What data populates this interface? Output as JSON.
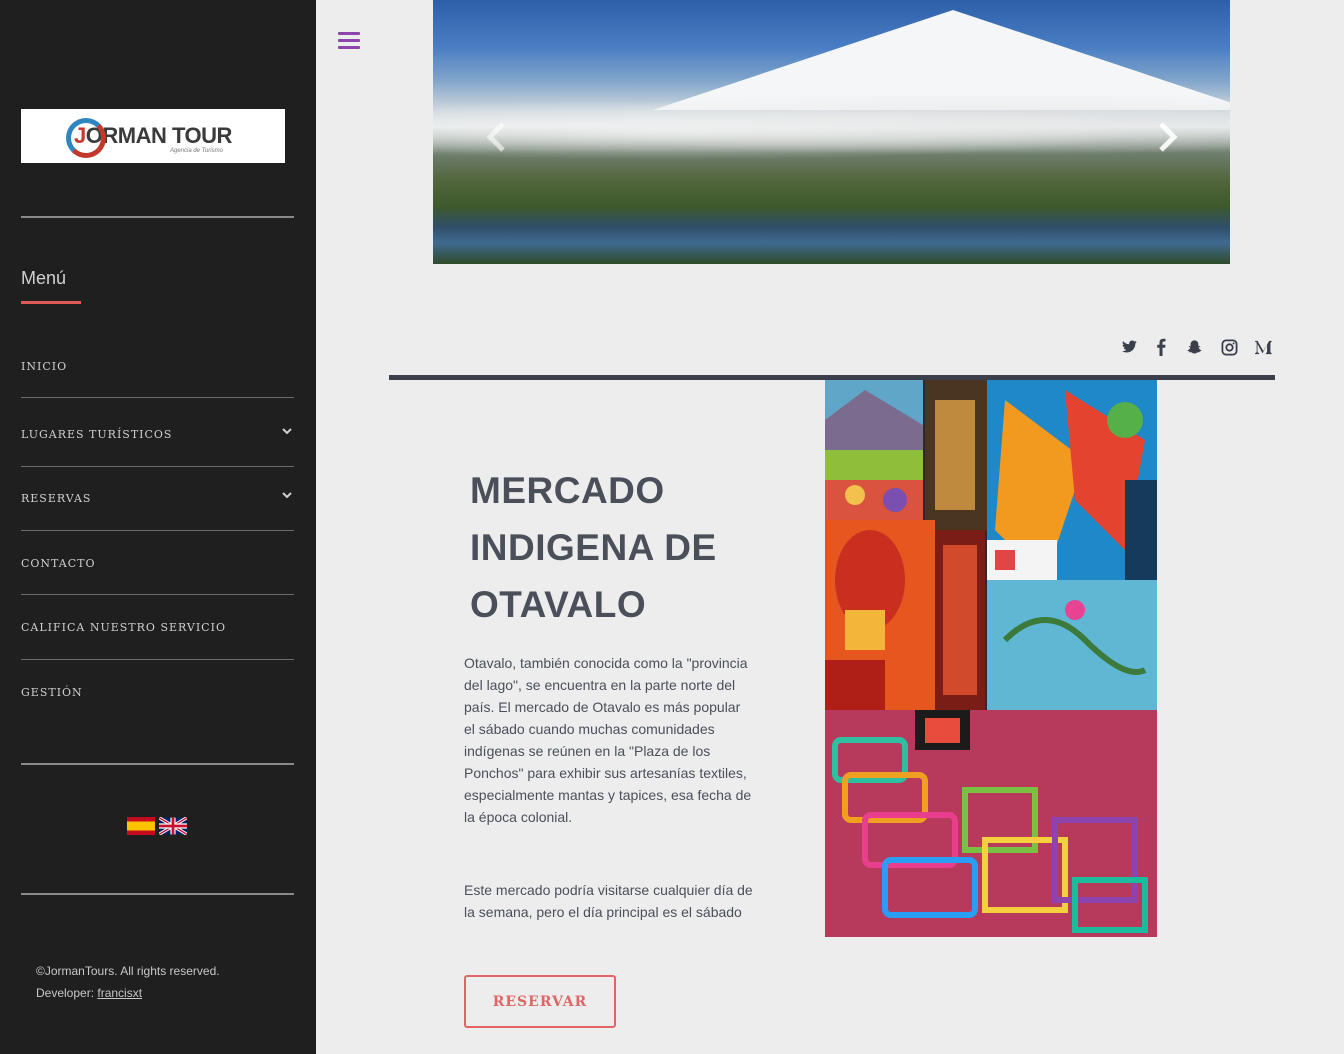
{
  "brand": {
    "logo_text_prefix": "J",
    "logo_text_main": "ORMAN TOUR",
    "logo_tagline": "Agencia de Turismo"
  },
  "sidebar": {
    "menu_title": "Menú",
    "items": [
      {
        "label": "INICIO",
        "has_submenu": false
      },
      {
        "label": "LUGARES TURÍSTICOS",
        "has_submenu": true
      },
      {
        "label": "RESERVAS",
        "has_submenu": true
      },
      {
        "label": "CONTACTO",
        "has_submenu": false
      },
      {
        "label": "CALIFICA NUESTRO SERVICIO",
        "has_submenu": false
      },
      {
        "label": "GESTIÓN",
        "has_submenu": false
      }
    ],
    "languages": [
      {
        "name": "spain-flag-icon"
      },
      {
        "name": "uk-flag-icon"
      }
    ],
    "footer": {
      "copyright": "©JormanTours. All rights reserved.",
      "developer_label": "Developer: ",
      "developer_link": "francisxt"
    }
  },
  "social": [
    "twitter-icon",
    "facebook-icon",
    "snapchat-icon",
    "instagram-icon",
    "medium-icon"
  ],
  "article": {
    "title_line1": "MERCADO",
    "title_line2": "INDIGENA DE",
    "title_line3": "OTAVALO",
    "paragraph1": "Otavalo, también conocida como la \"provincia del lago\", se encuentra en la parte norte del país. El mercado de Otavalo es más popular el sábado cuando muchas comunidades indígenas se reúnen en la \"Plaza de los Ponchos\" para exhibir sus artesanías textiles, especialmente mantas y tapices, esa fecha de la época colonial.",
    "paragraph2": "Este mercado podría visitarse cualquier día de la semana, pero el día principal es el sábado",
    "button_label": "RESERVAR"
  },
  "colors": {
    "sidebar_bg": "#1f1f1f",
    "accent_red": "#e06666",
    "hamburger_purple": "#8e44ad",
    "divider_dark": "#3a3f4b",
    "text_dark": "#4a4f5a"
  }
}
